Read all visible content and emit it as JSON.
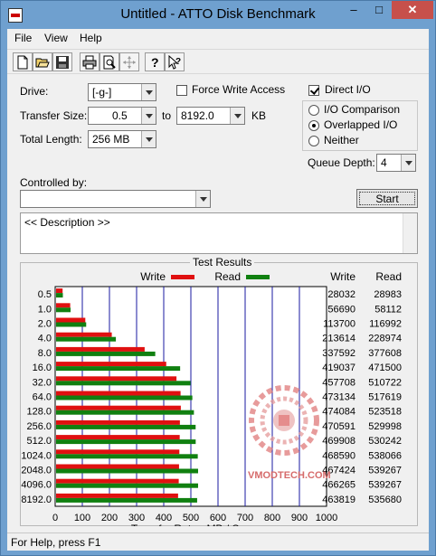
{
  "window": {
    "title": "Untitled - ATTO Disk Benchmark",
    "minimize": "–",
    "maximize": "□",
    "close": "✕"
  },
  "menu": [
    "File",
    "View",
    "Help"
  ],
  "toolbar": {
    "icons": [
      "new-document-icon",
      "open-folder-icon",
      "save-icon",
      "print-icon",
      "print-preview-icon",
      "move-icon",
      "help-icon",
      "context-help-icon"
    ]
  },
  "settings": {
    "drive_label": "Drive:",
    "drive_value": "[-g-]",
    "force_write_label": "Force Write Access",
    "force_write_checked": false,
    "direct_io_label": "Direct I/O",
    "direct_io_checked": true,
    "transfer_size_label": "Transfer Size:",
    "transfer_from": "0.5",
    "to_label": "to",
    "transfer_to": "8192.0",
    "kb_label": "KB",
    "total_length_label": "Total Length:",
    "total_length_value": "256 MB",
    "io_options": [
      "I/O Comparison",
      "Overlapped I/O",
      "Neither"
    ],
    "io_selected": 1,
    "queue_depth_label": "Queue Depth:",
    "queue_depth_value": "4",
    "controlled_by_label": "Controlled by:",
    "controlled_by_value": "",
    "start_label": "Start",
    "description": "<< Description >>"
  },
  "results_title": "Test Results",
  "chart_data": {
    "type": "bar",
    "categories": [
      "0.5",
      "1.0",
      "2.0",
      "4.0",
      "8.0",
      "16.0",
      "32.0",
      "64.0",
      "128.0",
      "256.0",
      "512.0",
      "1024.0",
      "2048.0",
      "4096.0",
      "8192.0"
    ],
    "series": [
      {
        "name": "Write",
        "color": "#e01010",
        "values": [
          28032,
          56690,
          113700,
          213614,
          337592,
          419037,
          457708,
          473134,
          474084,
          470591,
          469908,
          468590,
          467424,
          466265,
          463819
        ]
      },
      {
        "name": "Read",
        "color": "#108010",
        "values": [
          28983,
          58112,
          116992,
          228974,
          377608,
          471500,
          510722,
          517619,
          523518,
          529998,
          530242,
          538066,
          539267,
          539267,
          535680
        ]
      }
    ],
    "xlabel": "Transfer Rate - MB / Sec",
    "x_ticks": [
      "0",
      "100",
      "200",
      "300",
      "400",
      "500",
      "600",
      "700",
      "800",
      "900",
      "1000"
    ],
    "xlim": [
      0,
      1000
    ],
    "col_write": "Write",
    "col_read": "Read",
    "legend": "top",
    "grid": true
  },
  "watermark": "VMODTECH.COM",
  "status": "For Help, press F1"
}
